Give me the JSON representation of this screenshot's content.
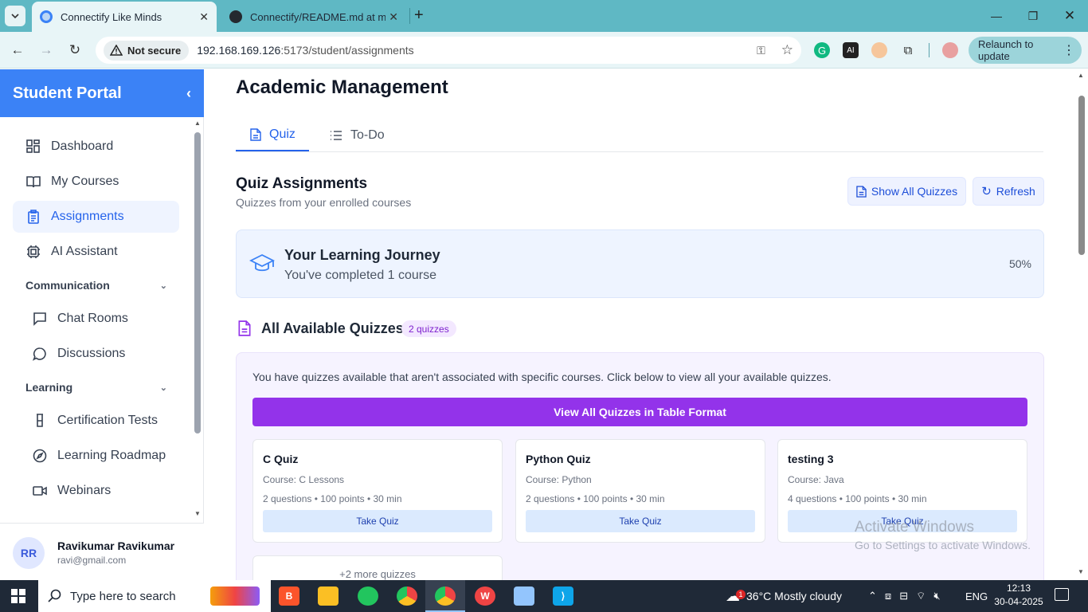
{
  "browser": {
    "tabs": [
      {
        "title": "Connectify Like Minds",
        "active": true
      },
      {
        "title": "Connectify/README.md at main",
        "active": false
      }
    ],
    "security_label": "Not secure",
    "url_host": "192.168.169.126",
    "url_path": ":5173/student/assignments",
    "relaunch_label": "Relaunch to update"
  },
  "sidebar": {
    "title": "Student Portal",
    "items": [
      {
        "label": "Dashboard"
      },
      {
        "label": "My Courses"
      },
      {
        "label": "Assignments",
        "active": true
      },
      {
        "label": "AI Assistant"
      }
    ],
    "communication": {
      "label": "Communication",
      "items": [
        {
          "label": "Chat Rooms"
        },
        {
          "label": "Discussions"
        }
      ]
    },
    "learning": {
      "label": "Learning",
      "items": [
        {
          "label": "Certification Tests"
        },
        {
          "label": "Learning Roadmap"
        },
        {
          "label": "Webinars"
        }
      ]
    },
    "user": {
      "initials": "RR",
      "name": "Ravikumar Ravikumar",
      "email": "ravi@gmail.com"
    }
  },
  "main": {
    "title": "Academic Management",
    "tabs": [
      {
        "label": "Quiz",
        "active": true
      },
      {
        "label": "To-Do"
      }
    ],
    "section_title": "Quiz Assignments",
    "section_subtitle": "Quizzes from your enrolled courses",
    "show_all_label": "Show All Quizzes",
    "refresh_label": "Refresh",
    "journey": {
      "title": "Your Learning Journey",
      "subtitle": "You've completed 1 course",
      "percent": "50%"
    },
    "quizzes_title": "All Available Quizzes",
    "quizzes_badge": "2 quizzes",
    "notice": "You have quizzes available that aren't associated with specific courses. Click below to view all your available quizzes.",
    "view_all_label": "View All Quizzes in Table Format",
    "cards": [
      {
        "title": "C Quiz",
        "course": "Course: C Lessons",
        "meta": "2 questions • 100 points • 30 min",
        "button": "Take Quiz"
      },
      {
        "title": "Python Quiz",
        "course": "Course: Python",
        "meta": "2 questions • 100 points • 30 min",
        "button": "Take Quiz"
      },
      {
        "title": "testing 3",
        "course": "Course: Java",
        "meta": "4 questions • 100 points • 30 min",
        "button": "Take Quiz"
      }
    ],
    "more_label": "+2 more quizzes"
  },
  "watermark": {
    "line1": "Activate Windows",
    "line2": "Go to Settings to activate Windows."
  },
  "taskbar": {
    "search_placeholder": "Type here to search",
    "weather": "36°C  Mostly cloudy",
    "weather_badge": "1",
    "language": "ENG",
    "time": "12:13",
    "date": "30-04-2025"
  },
  "colors": {
    "accent": "#3b82f6",
    "purple": "#9333ea",
    "browser": "#5fb8c4"
  },
  "icons": [
    "grid-icon",
    "book-icon",
    "clipboard-icon",
    "cpu-icon",
    "chat-icon",
    "comment-icon",
    "badge-icon",
    "compass-icon",
    "video-icon",
    "document-icon",
    "list-icon",
    "refresh-icon",
    "graduation-cap-icon"
  ]
}
